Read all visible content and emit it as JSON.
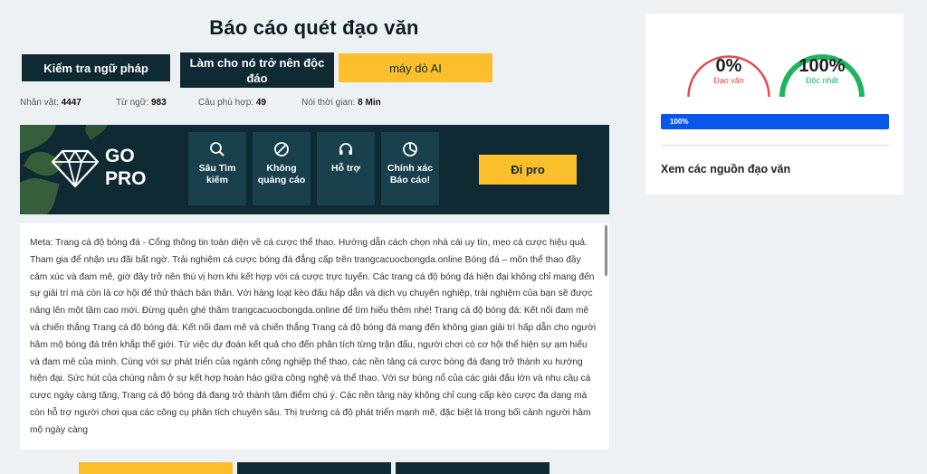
{
  "title": "Báo cáo quét đạo văn",
  "buttons": {
    "grammar": "Kiểm tra ngữ pháp",
    "unique": "Làm cho nó trở nên độc đáo",
    "ai": "máy dò AI"
  },
  "stats": {
    "characters_label": "Nhân vật:",
    "characters": "4447",
    "words_label": "Từ ngữ:",
    "words": "983",
    "matches_label": "Câu phù hợp:",
    "matches": "49",
    "time_label": "Nói thời gian:",
    "time": "8 Min"
  },
  "gopro": {
    "go": "GO",
    "pro": "PRO",
    "features": [
      {
        "label": "Sâu Tìm kiếm",
        "icon": "search-icon"
      },
      {
        "label": "Không quảng cáo",
        "icon": "no-ads-icon"
      },
      {
        "label": "Hỗ trợ",
        "icon": "headset-icon"
      },
      {
        "label": "Chính xác Báo cáo!",
        "icon": "chart-icon"
      }
    ],
    "cta": "Đi pro"
  },
  "content_text": "Meta: Trang cá độ bóng đá - Cổng thông tin toàn diện về cá cược thể thao. Hướng dẫn cách chọn nhà cái uy tín, mẹo cá cược hiệu quả. Tham gia để nhận ưu đãi bất ngờ. Trải nghiệm cá cược bóng đá đẳng cấp trên trangcacuocbongda.online Bóng đá – môn thể thao đầy cảm xúc và đam mê, giờ đây trở nên thú vị hơn khi kết hợp với cá cược trực tuyến. Các trang cá độ bóng đá hiện đại không chỉ mang đến sự giải trí mà còn là cơ hội để thử thách bản thân. Với hàng loạt kèo đấu hấp dẫn và dịch vụ chuyên nghiệp, trải nghiệm của bạn sẽ được nâng lên một tầm cao mới. Đừng quên ghé thăm trangcacuocbongda.online để tìm hiểu thêm nhé! Trang cá độ bóng đá: Kết nối đam mê và chiến thắng Trang cá độ bóng đá: Kết nối đam mê và chiến thắng Trang cá độ bóng đá mang đến không gian giải trí hấp dẫn cho người hâm mộ bóng đá trên khắp thế giới. Từ việc dự đoán kết quả cho đến phân tích từng trận đấu, người chơi có cơ hội thể hiện sự am hiểu và đam mê của mình. Cùng với sự phát triển của ngành công nghiệp thể thao, các nền tảng cá cược bóng đá đang trở thành xu hướng hiện đại. Sức hút của chúng nằm ở sự kết hợp hoàn hảo giữa công nghệ và thể thao. Với sự bùng nổ của các giải đấu lớn và nhu cầu cá cược ngày càng tăng, Trang cá độ bóng đá đang trở thành tâm điểm chú ý. Các nền tảng này không chỉ cung cấp kèo cược đa dạng mà còn hỗ trợ người chơi qua các công cụ phân tích chuyên sâu. Thị trường cá độ phát triển mạnh mẽ, đặc biệt là trong bối cảnh người hâm mộ ngày càng",
  "result": {
    "plagiarism_value": "0%",
    "plagiarism_label": "Đạo văn",
    "plagiarism_fraction": 0,
    "unique_value": "100%",
    "unique_label": "Độc nhất",
    "unique_fraction": 1,
    "progress_label": "100%",
    "progress_fraction": 1,
    "sources_link": "Xem các nguồn đạo văn"
  },
  "colors": {
    "dark": "#0f2a33",
    "yellow": "#fbbf2c",
    "red": "#e84a4a",
    "green": "#1fb55e",
    "blue": "#0a56e8"
  }
}
